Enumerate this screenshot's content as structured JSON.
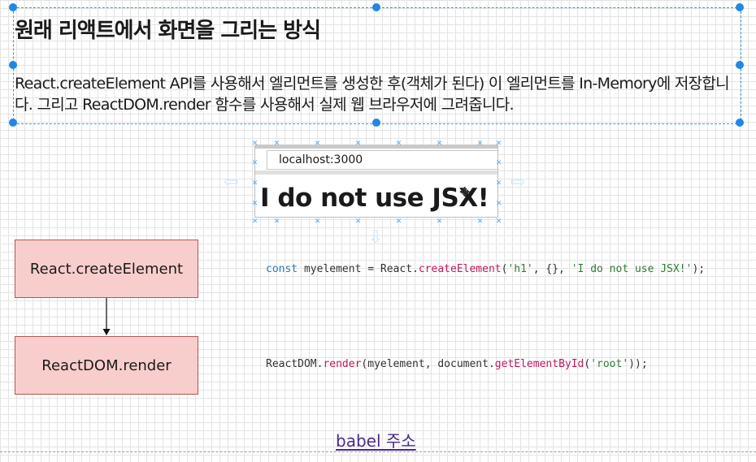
{
  "heading": "원래 리액트에서 화면을 그리는 방식",
  "description": "React.createElement  API를 사용해서 엘리먼트를 생성한 후(객체가 된다) 이 엘리먼트를 In-Memory에 저장합니다. 그리고 ReactDOM.render 함수를 사용해서 실제 웹 브라우저에 그려줍니다.",
  "browser": {
    "url": "localhost:3000",
    "headline": "I do not use JSX!"
  },
  "flow": {
    "step1": "React.createElement",
    "step2": "ReactDOM.render"
  },
  "code": {
    "line1": {
      "keyword": "const",
      "rest1": " myelement = React.",
      "fn": "createElement",
      "paren_open": "(",
      "arg1": "'h1'",
      "mid": ", {}, ",
      "arg2": "'I do not use JSX!'",
      "end": ");"
    },
    "line2": {
      "start": "ReactDOM.",
      "fn1": "render",
      "mid": "(myelement, document.",
      "fn2": "getElementById",
      "paren_open": "(",
      "arg": "'root'",
      "end": "));"
    }
  },
  "link": "babel 주소",
  "colors": {
    "box_fill": "#f8cecc",
    "box_border": "#b85450",
    "selection": "#1e88e5",
    "link": "#4a2b8a"
  }
}
